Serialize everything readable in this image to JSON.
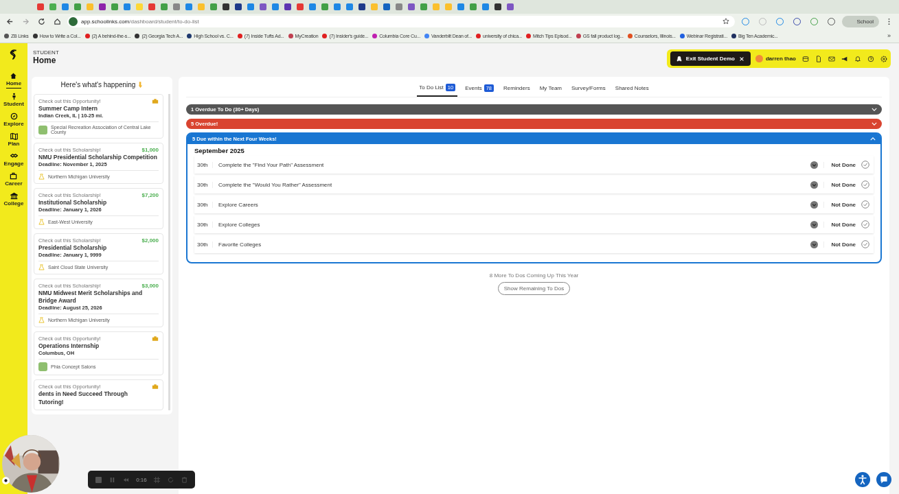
{
  "browser": {
    "url_host": "app.schoolinks.com",
    "url_path": "/dashboard/student/to-do-list",
    "profile": "School",
    "bookmarks": [
      {
        "label": "ZB Links",
        "color": "#555555"
      },
      {
        "label": "How to Write a Col...",
        "color": "#333333"
      },
      {
        "label": "(2) A behind-the-s...",
        "color": "#e02020"
      },
      {
        "label": "(2) Georgia Tech A...",
        "color": "#333333"
      },
      {
        "label": "High School vs. C...",
        "color": "#1f3a6e"
      },
      {
        "label": "(7) Inside Tufts Ad...",
        "color": "#e02020"
      },
      {
        "label": "MyCreation",
        "color": "#c04050"
      },
      {
        "label": "(7) Insider's guide...",
        "color": "#e02020"
      },
      {
        "label": "Columbia Core Cu...",
        "color": "#c020b0"
      },
      {
        "label": "Vanderbilt Dean of...",
        "color": "#4285f4"
      },
      {
        "label": "university of chica...",
        "color": "#e02020"
      },
      {
        "label": "Mitch Tips Episod...",
        "color": "#e02020"
      },
      {
        "label": "GS fall product log...",
        "color": "#c04050"
      },
      {
        "label": "Counselors, Illinois...",
        "color": "#e05020"
      },
      {
        "label": "Webinar Registrati...",
        "color": "#2060e0"
      },
      {
        "label": "Big Ten Academic...",
        "color": "#203060"
      }
    ],
    "overflow": "»"
  },
  "nav": [
    {
      "label": "Home",
      "selected": true
    },
    {
      "label": "Student",
      "selected": false
    },
    {
      "label": "Explore",
      "selected": false
    },
    {
      "label": "Plan",
      "selected": false
    },
    {
      "label": "Engage",
      "selected": false
    },
    {
      "label": "Career",
      "selected": false
    },
    {
      "label": "College",
      "selected": false
    }
  ],
  "header": {
    "eyebrow": "STUDENT",
    "title": "Home",
    "exit_button": "Exit Student Demo",
    "user": "darren thao"
  },
  "feed": {
    "title": "Here's what's happening",
    "cards": [
      {
        "kind": "opportunity",
        "label": "Check out this Opportunity!",
        "title": "Summer Camp Intern",
        "subtitle": "**Indian Creek, IL** | 10-25 mi.",
        "org": "Special Recreation Association of Central Lake County"
      },
      {
        "kind": "scholarship",
        "label": "Check out this Scholarship!",
        "amount": "$1,000",
        "title": "NMU Presidential Scholarship Competition",
        "subtitle": "Deadline: November 1, 2025",
        "org": "Northern Michigan University"
      },
      {
        "kind": "scholarship",
        "label": "Check out this Scholarship!",
        "amount": "$7,200",
        "title": "Institutional Scholarship",
        "subtitle": "Deadline: January 1, 2026",
        "org": "East-West University"
      },
      {
        "kind": "scholarship",
        "label": "Check out this Scholarship!",
        "amount": "$2,000",
        "title": "Presidential Scholarship",
        "subtitle": "Deadline: January 1, 9999",
        "org": "Saint Cloud State University"
      },
      {
        "kind": "scholarship",
        "label": "Check out this Scholarship!",
        "amount": "$3,000",
        "title": "NMU Midwest Merit Scholarships and Bridge Award",
        "subtitle": "Deadline: August 25, 2026",
        "org": "Northern Michigan University"
      },
      {
        "kind": "opportunity",
        "label": "Check out this Opportunity!",
        "title": "Operations Internship",
        "subtitle": "**Columbus, OH**",
        "org": "Phia Concept Salons"
      },
      {
        "kind": "opportunity",
        "label": "Check out this Opportunity!",
        "title": "dents in Need Succeed Through",
        "title_line_2": "Tutoring!"
      }
    ]
  },
  "tabs": [
    {
      "label": "To Do List",
      "count": "10",
      "selected": true
    },
    {
      "label": "Events",
      "count": "78",
      "selected": false
    },
    {
      "label": "Reminders",
      "selected": false
    },
    {
      "label": "My Team",
      "selected": false
    },
    {
      "label": "Survey/Forms",
      "selected": false
    },
    {
      "label": "Shared Notes",
      "selected": false
    }
  ],
  "groups": [
    {
      "label": "1 Overdue To Do (30+ Days)",
      "color": "#555555",
      "expanded": false
    },
    {
      "label": "5 Overdue!",
      "color": "#d94430",
      "expanded": false
    },
    {
      "label": "5 Due within the Next Four Weeks!",
      "color": "#1976d2",
      "expanded": true,
      "month": "September 2025",
      "todos": [
        {
          "day": "30th",
          "title": "Complete the \"Find Your Path\" Assessment",
          "status": "Not Done",
          "done": false
        },
        {
          "day": "30th",
          "title": "Complete the \"Would You Rather\" Assessment",
          "status": "Not Done",
          "done": false
        },
        {
          "day": "30th",
          "title": "Explore Careers",
          "status": "Not Done",
          "done": false
        },
        {
          "day": "30th",
          "title": "Explore Colleges",
          "status": "Not Done",
          "done": false
        },
        {
          "day": "30th",
          "title": "Favorite Colleges",
          "status": "Not Done",
          "done": false
        }
      ]
    }
  ],
  "more_text": "8 More To Dos Coming Up This Year",
  "more_button": "Show Remaining To Dos",
  "recorder": {
    "time": "0:16"
  }
}
